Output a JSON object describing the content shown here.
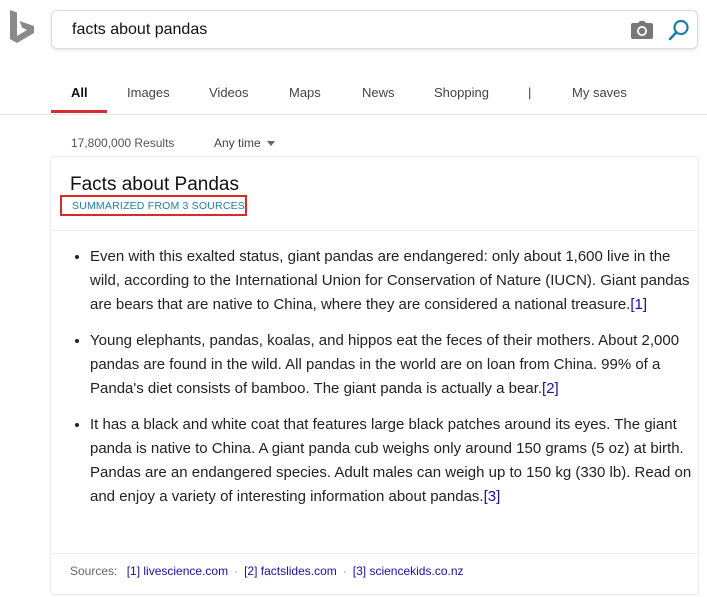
{
  "search": {
    "query": "facts about pandas"
  },
  "icons": {
    "logo": "bing-logo",
    "camera": "camera-icon",
    "search": "search-icon"
  },
  "tabs": [
    {
      "label": "All"
    },
    {
      "label": "Images"
    },
    {
      "label": "Videos"
    },
    {
      "label": "Maps"
    },
    {
      "label": "News"
    },
    {
      "label": "Shopping"
    },
    {
      "label": "|"
    },
    {
      "label": "My saves"
    }
  ],
  "results": {
    "count": "17,800,000 Results",
    "time_filter": "Any time"
  },
  "card": {
    "title": "Facts about Pandas",
    "summary_label": "SUMMARIZED FROM 3 SOURCES",
    "bullets": [
      {
        "text": "Even with this exalted status, giant pandas are endangered: only about 1,600 live in the wild, according to the International Union for Conservation of Nature (IUCN). Giant pandas are bears that are native to China, where they are considered a national treasure.",
        "cite": "[1]"
      },
      {
        "text": "Young elephants, pandas, koalas, and hippos eat the feces of their mothers. About 2,000 pandas are found in the wild. All pandas in the world are on loan from China. 99% of a Panda's diet consists of bamboo. The giant panda is actually a bear.",
        "cite": "[2]"
      },
      {
        "text": "It has a black and white coat that features large black patches around its eyes. The giant panda is native to China. A giant panda cub weighs only around 150 grams (5 oz) at birth. Pandas are an endangered species. Adult males can weigh up to 150 kg (330 lb). Read on and enjoy a variety of interesting information about pandas.",
        "cite": "[3]"
      }
    ],
    "sources_label": "Sources:",
    "sources": [
      "[1] livescience.com",
      "[2] factslides.com",
      "[3] sciencekids.co.nz"
    ],
    "source_separator": "·"
  },
  "colors": {
    "tab_active_underline": "#d32f2f",
    "summary_box_border": "#d52b2b",
    "summary_text": "#1a7fa8",
    "link": "#1a0dab",
    "bing_logo": "#8a8a8a",
    "search_icon": "#1a7fa8"
  }
}
